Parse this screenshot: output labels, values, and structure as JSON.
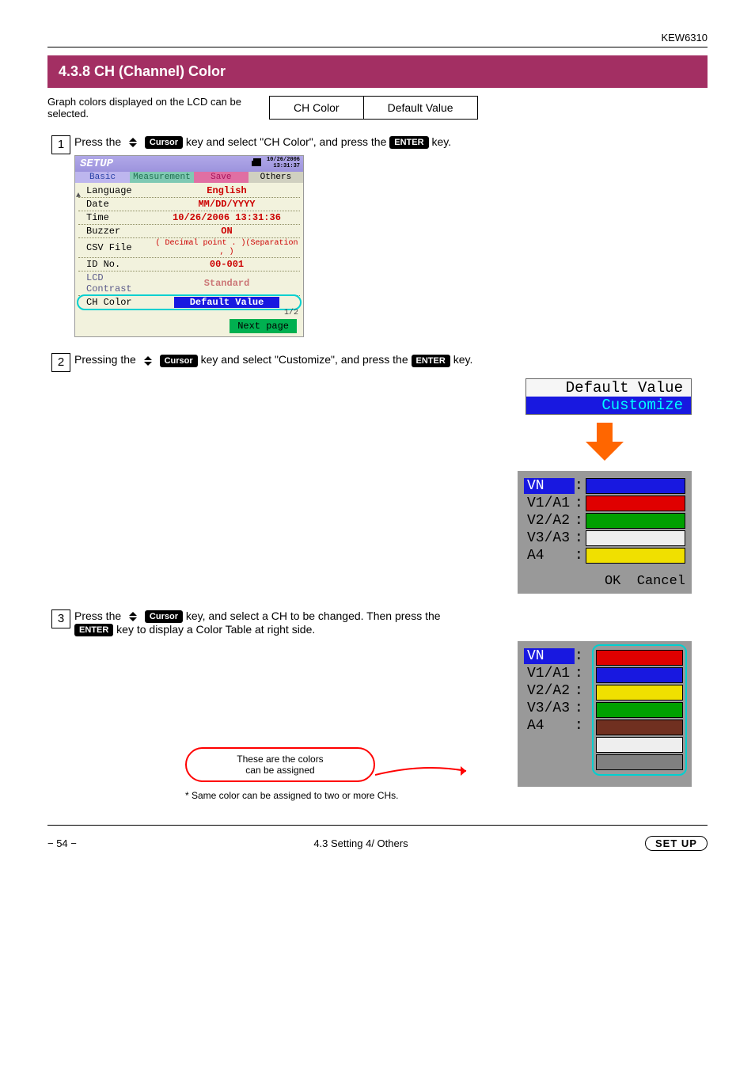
{
  "header_right": "KEW6310",
  "banner": "4.3.8 CH (Channel) Color",
  "top_text": "Graph colors displayed on the LCD can be\nselected.",
  "top_table": {
    "left": "CH Color",
    "right": "Default Value"
  },
  "steps": {
    "s1": {
      "num": "1",
      "line_a": "Press the",
      "line_b": "Cursor",
      "line_c": "key and select \"CH Color\", and press the",
      "line_d": "ENTER",
      "line_e": "key."
    },
    "s2": {
      "num": "2",
      "line_a": "Pressing the",
      "line_b": "Cursor",
      "line_c": "key and select \"Customize\", and press the",
      "line_d": "ENTER",
      "line_e": "key.",
      "opt1": "Default Value",
      "opt2": "Customize"
    },
    "s3": {
      "num": "3",
      "line_a": "Press the",
      "line_b": "Cursor",
      "line_c": "key, and select a CH to be changed. Then press the",
      "line_d": "ENTER",
      "line_e": "key to display a Color Table at right side."
    }
  },
  "device": {
    "title": "SETUP",
    "date1": "10/26/2006",
    "date2": "13:31:37",
    "tabs": {
      "basic": "Basic",
      "measure": "Measurement",
      "save": "Save",
      "others": "Others"
    },
    "rows": {
      "lang": {
        "lbl": "Language",
        "val": "English"
      },
      "date": {
        "lbl": "Date",
        "val": "MM/DD/YYYY"
      },
      "time": {
        "lbl": "Time",
        "val": "10/26/2006 13:31:36"
      },
      "buzzer": {
        "lbl": "Buzzer",
        "val": "ON"
      },
      "csv": {
        "lbl": "CSV File",
        "val": "( Decimal point . )(Separation , )"
      },
      "id": {
        "lbl": "ID No.",
        "val": "00-001"
      },
      "contrast": {
        "lbl": "LCD Contrast",
        "val": "Standard"
      },
      "chcolor": {
        "lbl": "CH Color",
        "val": "Default Value"
      }
    },
    "pagecount": "1/2",
    "nextpage": "Next page"
  },
  "channels": {
    "vn": "VN",
    "v1": "V1/A1",
    "v2": "V2/A2",
    "v3": "V3/A3",
    "a4": "A4",
    "ok": "OK",
    "cancel": "Cancel"
  },
  "colors_initial": {
    "vn": "#1818e0",
    "v1": "#e00000",
    "v2": "#00a000",
    "v3": "#eeeeee",
    "a4": "#f0e000"
  },
  "color_table": [
    "#e00000",
    "#1818e0",
    "#f0e000",
    "#00a000",
    "#703020",
    "#eeeeee",
    "#808080"
  ],
  "callout_text": "These are the colors\ncan be assigned",
  "footnote": "*  Same color can be assigned to two or more CHs.",
  "footer": {
    "left": "− 54 −",
    "center": "4.3 Setting 4/ Others",
    "right": "SET UP"
  }
}
